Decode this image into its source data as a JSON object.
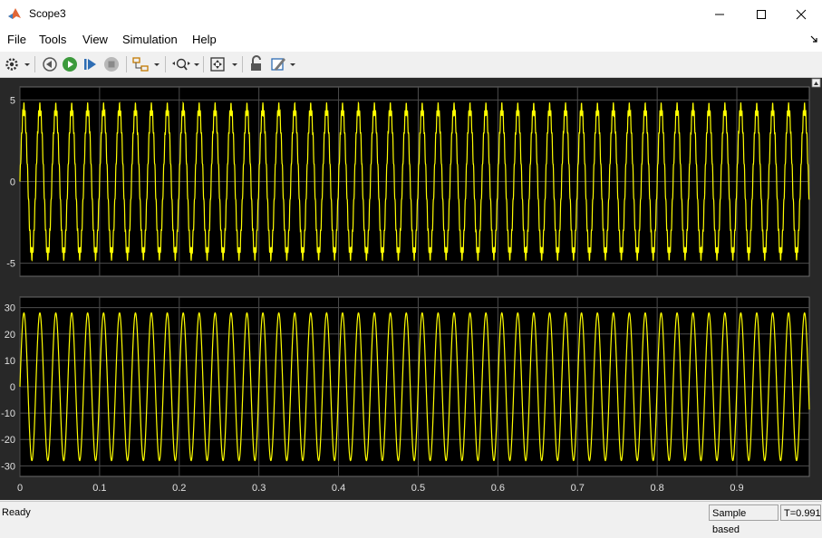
{
  "window": {
    "title": "Scope3"
  },
  "menu": [
    "File",
    "Tools",
    "View",
    "Simulation",
    "Help"
  ],
  "toolbar": {
    "icons": [
      "settings-icon",
      "step-back-icon",
      "run-icon",
      "step-forward-icon",
      "stop-icon",
      "highlight-icon",
      "zoom-icon",
      "fit-axes-icon",
      "lock-icon",
      "style-icon"
    ]
  },
  "status": {
    "text": "Ready",
    "sample_mode": "Sample based",
    "time": "T=0.991"
  },
  "colors": {
    "trace": "#ffff00",
    "plot_bg": "#000000",
    "figure_bg": "#282828",
    "grid": "#4d4d4d"
  },
  "chart_data": [
    {
      "type": "line",
      "xlim": [
        0,
        0.991
      ],
      "ylim": [
        -5.8,
        5.8
      ],
      "yticks": [
        "5",
        "0",
        "-5"
      ],
      "ytick_values": [
        5,
        0,
        -5
      ],
      "grid": true,
      "series": [
        {
          "signal": "sine",
          "amplitude": 4.5,
          "frequency_hz": 50,
          "ripple": true
        }
      ]
    },
    {
      "type": "line",
      "xlim": [
        0,
        0.991
      ],
      "ylim": [
        -34,
        34
      ],
      "yticks": [
        "30",
        "20",
        "10",
        "0",
        "-10",
        "-20",
        "-30"
      ],
      "ytick_values": [
        30,
        20,
        10,
        0,
        -10,
        -20,
        -30
      ],
      "xticks": [
        "0",
        "0.1",
        "0.2",
        "0.3",
        "0.4",
        "0.5",
        "0.6",
        "0.7",
        "0.8",
        "0.9"
      ],
      "xtick_values": [
        0,
        0.1,
        0.2,
        0.3,
        0.4,
        0.5,
        0.6,
        0.7,
        0.8,
        0.9
      ],
      "grid": true,
      "series": [
        {
          "signal": "sine",
          "amplitude": 28,
          "frequency_hz": 50,
          "ripple": false
        }
      ]
    }
  ]
}
